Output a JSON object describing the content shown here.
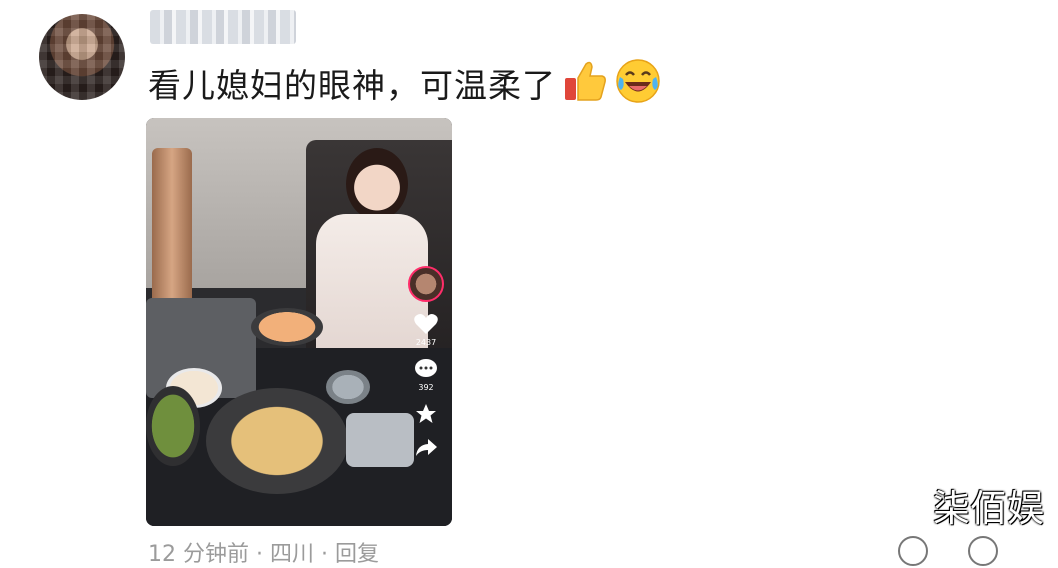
{
  "comment": {
    "text": "看儿媳妇的眼神，可温柔了",
    "emojis": [
      "thumbs-up-icon",
      "laughing-crying-emoji"
    ],
    "username_blurred": "username"
  },
  "video_overlay": {
    "like_count": "2437",
    "comment_count": "392"
  },
  "watermark": "柒佰娱",
  "footer": {
    "partial_text": "12 分钟前 · 四川 · 回复"
  },
  "colors": {
    "accent_pink": "#ff2d6a",
    "text_primary": "#1a1a1a"
  }
}
